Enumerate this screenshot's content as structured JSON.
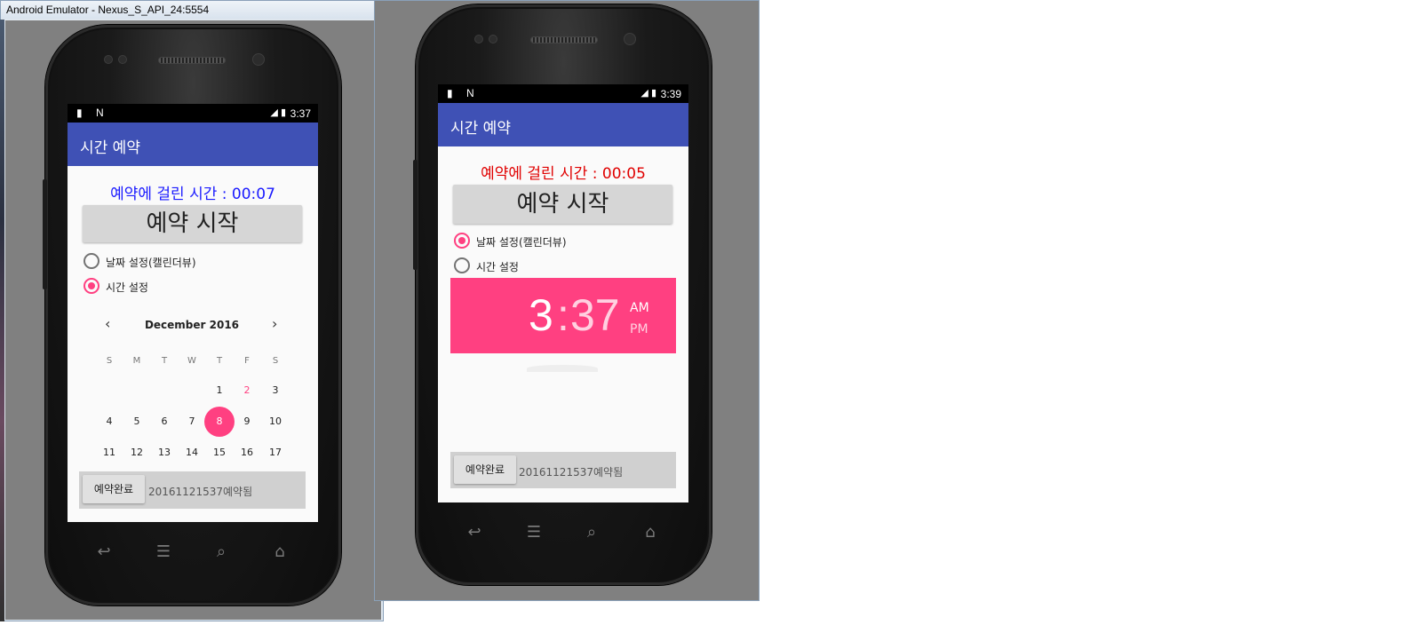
{
  "window": {
    "title": "Android Emulator - Nexus_S_API_24:5554"
  },
  "left": {
    "status_time": "3:37",
    "app_title": "시간 예약",
    "elapsed": "예약에 걸린 시간 : 00:07",
    "elapsed_color": "#1a1aff",
    "start_button": "예약 시작",
    "radio_date": "날짜 설정(캘린더뷰)",
    "radio_time": "시간 설정",
    "selected_radio": "time",
    "calendar": {
      "month": "December 2016",
      "weekdays": [
        "S",
        "M",
        "T",
        "W",
        "T",
        "F",
        "S"
      ],
      "weeks": [
        [
          "",
          "",
          "",
          "",
          "1",
          "2",
          "3"
        ],
        [
          "4",
          "5",
          "6",
          "7",
          "8",
          "9",
          "10"
        ],
        [
          "11",
          "12",
          "13",
          "14",
          "15",
          "16",
          "17"
        ]
      ],
      "today": "2",
      "selected": "8"
    },
    "done_button": "예약완료",
    "done_text": "20161121537예약됨"
  },
  "right": {
    "status_time": "3:39",
    "app_title": "시간 예약",
    "elapsed": "예약에 걸린 시간 : 00:05",
    "elapsed_color": "#e00000",
    "start_button": "예약 시작",
    "radio_date": "날짜 설정(캘린더뷰)",
    "radio_time": "시간 설정",
    "selected_radio": "date",
    "time_picker": {
      "hour": "3",
      "colon": ":",
      "minute": "37",
      "am": "AM",
      "pm": "PM"
    },
    "done_button": "예약완료",
    "done_text": "20161121537예약됨"
  },
  "colors": {
    "accent": "#ff4081",
    "primary": "#3f51b5",
    "emulator_bg": "#808080"
  },
  "icons": [
    "sd-card-icon",
    "n-notification-icon",
    "signal-icon",
    "battery-icon",
    "back-icon",
    "menu-icon",
    "search-icon",
    "home-icon"
  ]
}
